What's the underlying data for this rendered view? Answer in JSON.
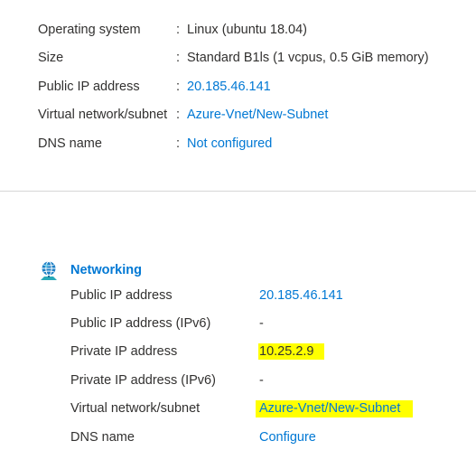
{
  "essentials": [
    {
      "label": "Operating system",
      "value": "Linux (ubuntu 18.04)",
      "is_link": false
    },
    {
      "label": "Size",
      "value": "Standard B1ls (1 vcpus, 0.5 GiB memory)",
      "is_link": false
    },
    {
      "label": "Public IP address",
      "value": "20.185.46.141",
      "is_link": true
    },
    {
      "label": "Virtual network/subnet",
      "value": "Azure-Vnet/New-Subnet",
      "is_link": true
    },
    {
      "label": "DNS name",
      "value": "Not configured",
      "is_link": true
    }
  ],
  "separator": ":",
  "networking": {
    "title": "Networking",
    "icon": "networking-globe-icon",
    "rows": [
      {
        "label": "Public IP address",
        "value": "20.185.46.141",
        "is_link": true,
        "highlighted": false
      },
      {
        "label": "Public IP address (IPv6)",
        "value": "-",
        "is_link": false,
        "highlighted": false
      },
      {
        "label": "Private IP address",
        "value": "10.25.2.9",
        "is_link": false,
        "highlighted": true
      },
      {
        "label": "Private IP address (IPv6)",
        "value": "-",
        "is_link": false,
        "highlighted": false
      },
      {
        "label": "Virtual network/subnet",
        "value": "Azure-Vnet/New-Subnet",
        "is_link": true,
        "highlighted": true
      },
      {
        "label": "DNS name",
        "value": "Configure",
        "is_link": true,
        "highlighted": false
      }
    ]
  },
  "colors": {
    "link": "#0078d4",
    "text": "#323130",
    "highlight": "#ffff00",
    "divider": "#d6d6d6"
  }
}
